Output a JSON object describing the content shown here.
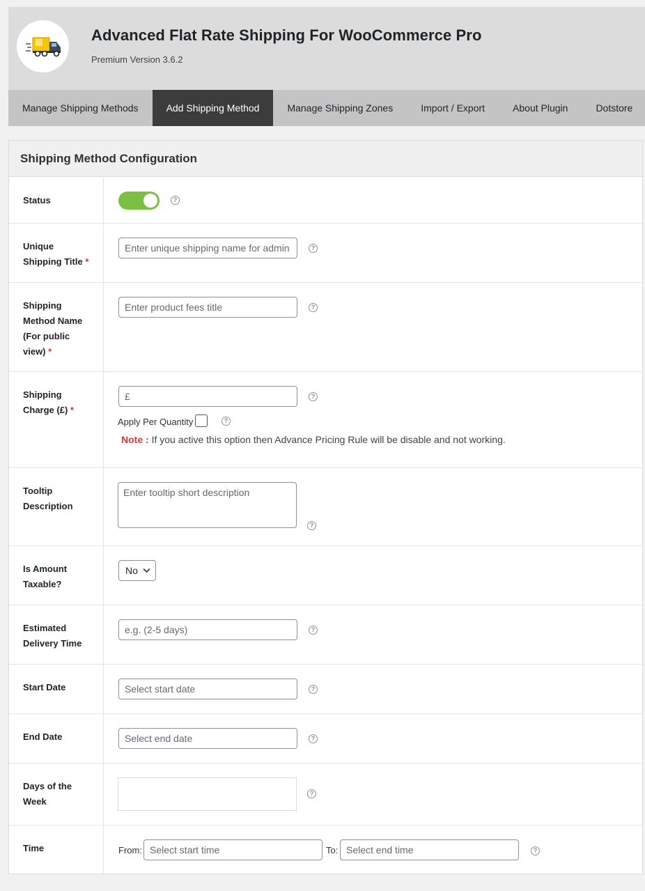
{
  "header": {
    "title": "Advanced Flat Rate Shipping For WooCommerce Pro",
    "version": "Premium Version 3.6.2",
    "logo_icon": "delivery-truck-icon"
  },
  "nav": {
    "tabs": [
      {
        "label": "Manage Shipping Methods",
        "active": false
      },
      {
        "label": "Add Shipping Method",
        "active": true
      },
      {
        "label": "Manage Shipping Zones",
        "active": false
      },
      {
        "label": "Import / Export",
        "active": false
      },
      {
        "label": "About Plugin",
        "active": false
      },
      {
        "label": "Dotstore",
        "active": false
      }
    ]
  },
  "panel": {
    "title": "Shipping Method Configuration"
  },
  "fields": {
    "status": {
      "label": "Status",
      "enabled": true
    },
    "unique_title": {
      "label_line1": "Unique",
      "label_line2": "Shipping Title",
      "required": "*",
      "placeholder": "Enter unique shipping name for admin"
    },
    "method_name": {
      "label_line1": "Shipping",
      "label_line2": "Method Name",
      "label_line3": "(For public",
      "label_line4": "view)",
      "required": "*",
      "placeholder": "Enter product fees title"
    },
    "shipping_charge": {
      "label_line1": "Shipping",
      "label_line2": "Charge (£)",
      "required": "*",
      "placeholder": "£",
      "per_qty_label": "Apply Per Quantity",
      "note_label": "Note :",
      "note_text": "If you active this option then Advance Pricing Rule will be disable and not working."
    },
    "tooltip": {
      "label_line1": "Tooltip",
      "label_line2": "Description",
      "placeholder": "Enter tooltip short description"
    },
    "taxable": {
      "label_line1": "Is Amount",
      "label_line2": "Taxable?",
      "value": "No"
    },
    "delivery_time": {
      "label_line1": "Estimated",
      "label_line2": "Delivery Time",
      "placeholder": "e.g. (2-5 days)"
    },
    "start_date": {
      "label": "Start Date",
      "placeholder": "Select start date"
    },
    "end_date": {
      "label": "End Date",
      "placeholder": "Select end date"
    },
    "days_of_week": {
      "label_line1": "Days of the",
      "label_line2": "Week"
    },
    "time": {
      "label": "Time",
      "from_label": "From:",
      "from_placeholder": "Select start time",
      "to_label": "To:",
      "to_placeholder": "Select end time"
    }
  },
  "colors": {
    "toggle_on": "#7ac143",
    "active_tab": "#3c3c3c",
    "required": "#d63638"
  }
}
